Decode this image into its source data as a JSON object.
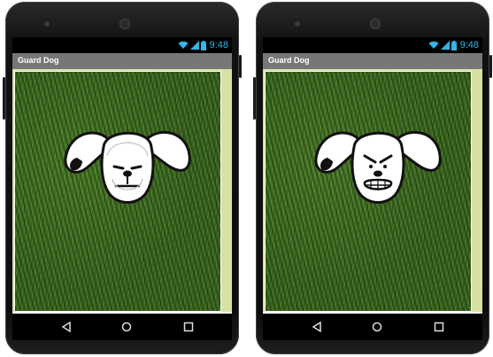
{
  "phones": [
    {
      "status": {
        "time": "9:48"
      },
      "app_title": "Guard Dog",
      "dog_mood": "calm"
    },
    {
      "status": {
        "time": "9:48"
      },
      "app_title": "Guard Dog",
      "dog_mood": "angry"
    }
  ],
  "icons": [
    "wifi-icon",
    "signal-icon",
    "battery-icon",
    "back-icon",
    "home-icon",
    "recents-icon"
  ],
  "colors": {
    "status_accent": "#33b5e5",
    "title_bar": "#777777",
    "screen_edge": "#d7e2a2",
    "grass": "#3e6b22"
  }
}
